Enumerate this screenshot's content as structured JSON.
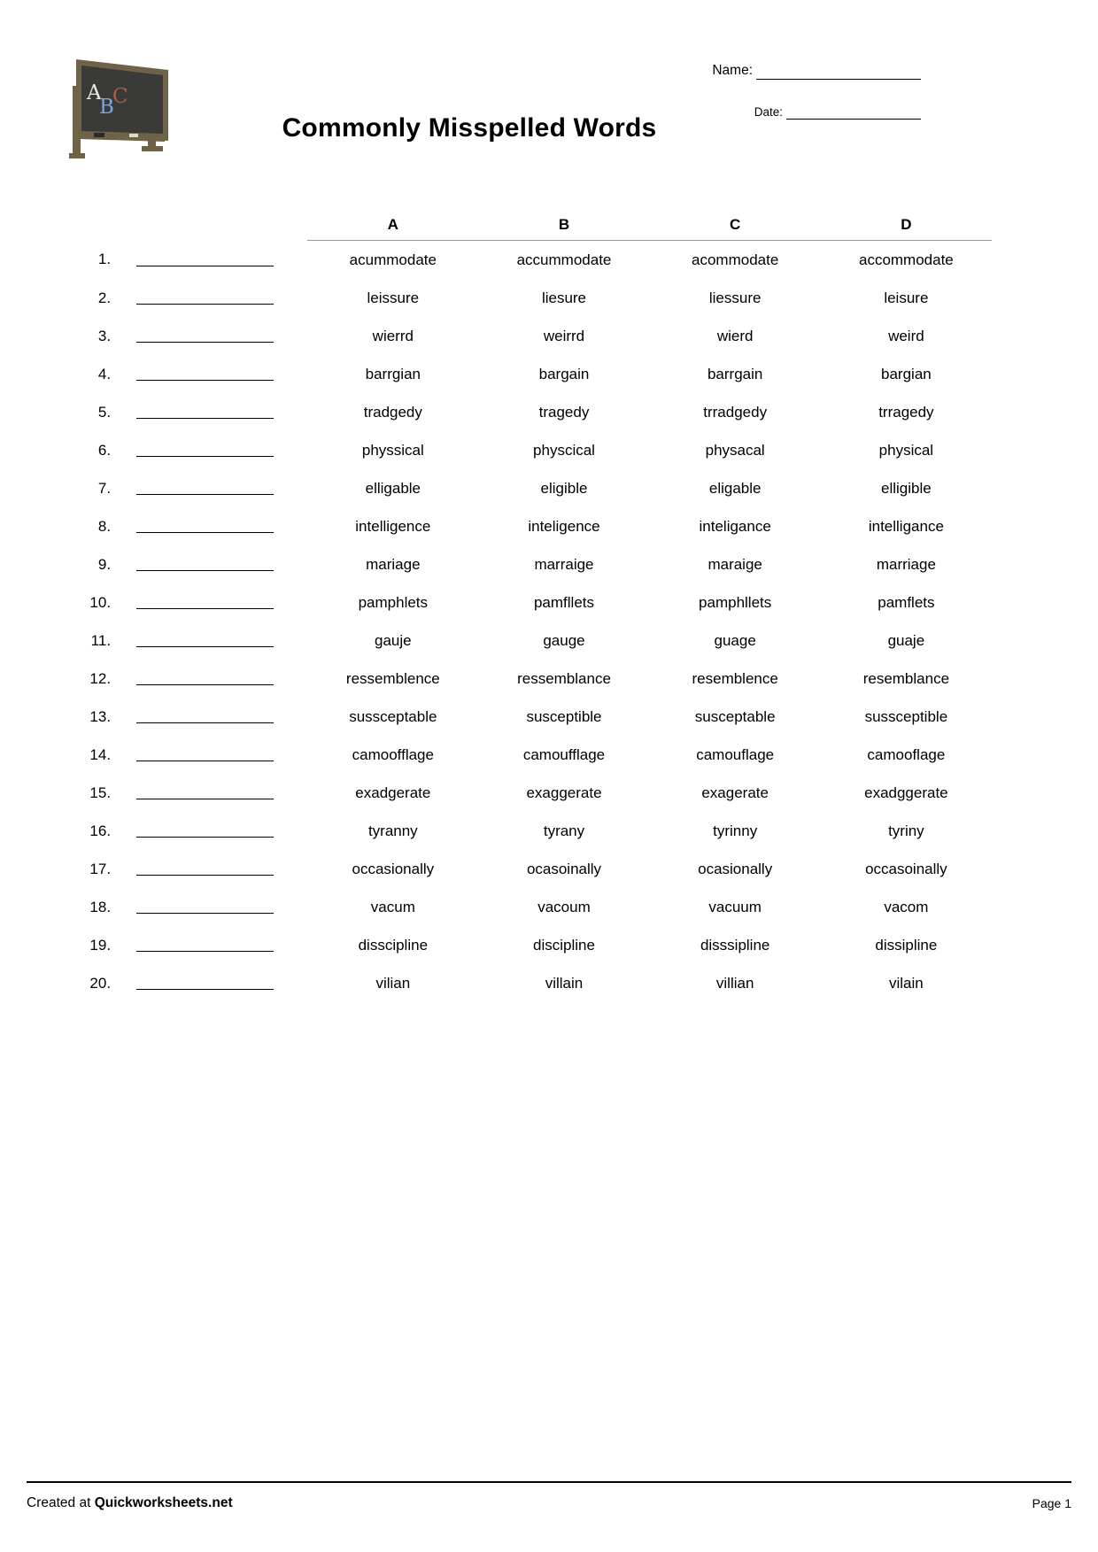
{
  "header": {
    "title": "Commonly Misspelled Words",
    "name_label": "Name:",
    "date_label": "Date:",
    "chalkboard_letters": [
      "A",
      "B",
      "C"
    ]
  },
  "table": {
    "columns": [
      "A",
      "B",
      "C",
      "D"
    ],
    "rows": [
      {
        "num": "1.",
        "options": [
          "acummodate",
          "accummodate",
          "acommodate",
          "accommodate"
        ]
      },
      {
        "num": "2.",
        "options": [
          "leissure",
          "liesure",
          "liessure",
          "leisure"
        ]
      },
      {
        "num": "3.",
        "options": [
          "wierrd",
          "weirrd",
          "wierd",
          "weird"
        ]
      },
      {
        "num": "4.",
        "options": [
          "barrgian",
          "bargain",
          "barrgain",
          "bargian"
        ]
      },
      {
        "num": "5.",
        "options": [
          "tradgedy",
          "tragedy",
          "trradgedy",
          "trragedy"
        ]
      },
      {
        "num": "6.",
        "options": [
          "physsical",
          "physcical",
          "physacal",
          "physical"
        ]
      },
      {
        "num": "7.",
        "options": [
          "elligable",
          "eligible",
          "eligable",
          "elligible"
        ]
      },
      {
        "num": "8.",
        "options": [
          "intelligence",
          "inteligence",
          "inteligance",
          "intelligance"
        ]
      },
      {
        "num": "9.",
        "options": [
          "mariage",
          "marraige",
          "maraige",
          "marriage"
        ]
      },
      {
        "num": "10.",
        "options": [
          "pamphlets",
          "pamfllets",
          "pamphllets",
          "pamflets"
        ]
      },
      {
        "num": "11.",
        "options": [
          "gauje",
          "gauge",
          "guage",
          "guaje"
        ]
      },
      {
        "num": "12.",
        "options": [
          "ressemblence",
          "ressemblance",
          "resemblence",
          "resemblance"
        ]
      },
      {
        "num": "13.",
        "options": [
          "sussceptable",
          "susceptible",
          "susceptable",
          "sussceptible"
        ]
      },
      {
        "num": "14.",
        "options": [
          "camoofflage",
          "camoufflage",
          "camouflage",
          "camooflage"
        ]
      },
      {
        "num": "15.",
        "options": [
          "exadgerate",
          "exaggerate",
          "exagerate",
          "exadggerate"
        ]
      },
      {
        "num": "16.",
        "options": [
          "tyranny",
          "tyrany",
          "tyrinny",
          "tyriny"
        ]
      },
      {
        "num": "17.",
        "options": [
          "occasionally",
          "ocasoinally",
          "ocasionally",
          "occasoinally"
        ]
      },
      {
        "num": "18.",
        "options": [
          "vacum",
          "vacoum",
          "vacuum",
          "vacom"
        ]
      },
      {
        "num": "19.",
        "options": [
          "disscipline",
          "discipline",
          "disssipline",
          "dissipline"
        ]
      },
      {
        "num": "20.",
        "options": [
          "vilian",
          "villain",
          "villian",
          "vilain"
        ]
      }
    ]
  },
  "footer": {
    "created_prefix": "Created at ",
    "created_brand": "Quickworksheets.net",
    "page_label": "Page 1"
  },
  "colors": {
    "rule": "#9a9a9a",
    "text": "#000000",
    "board_frame": "#6f6347",
    "board_face": "#3a3a38"
  }
}
